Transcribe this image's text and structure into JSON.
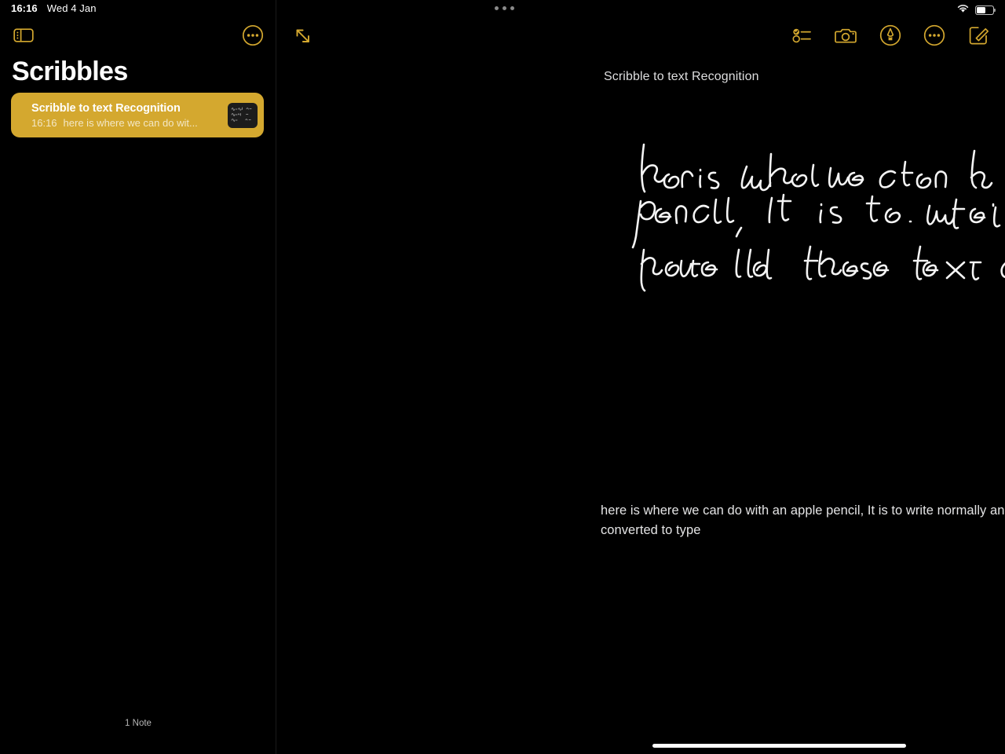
{
  "status_bar": {
    "time": "16:16",
    "date": "Wed 4 Jan",
    "multitask_dots_icon": "multitasking-dots-icon",
    "wifi_icon": "wifi-icon",
    "battery_icon": "battery-icon",
    "battery_level_percent": 47
  },
  "sidebar": {
    "toggle_icon": "sidebar-toggle-icon",
    "more_icon": "more-circle-icon",
    "title": "Scribbles",
    "note": {
      "title": "Scribble to text Recognition",
      "time": "16:16",
      "snippet": "here is where we can do wit...",
      "thumbnail_icon": "note-thumbnail-icon",
      "accent_color": "#d4a82f"
    },
    "footer_count": "1 Note"
  },
  "detail": {
    "expand_icon": "expand-diagonal-icon",
    "toolbar_icons": [
      {
        "name": "checklist-icon",
        "label": "Checklist"
      },
      {
        "name": "camera-icon",
        "label": "Camera"
      },
      {
        "name": "markup-pen-icon",
        "label": "Markup"
      },
      {
        "name": "more-circle-icon",
        "label": "More"
      },
      {
        "name": "compose-icon",
        "label": "New Note"
      }
    ],
    "note_heading": "Scribble to text Recognition",
    "handwriting_lines": [
      "here is what we can do with an apple",
      "pencil, It is to write normally and then",
      "have all these text converted to type"
    ],
    "converted_text": "here is where we can do with an apple pencil, It is to write normally and then have all these text converted to type",
    "home_indicator": "home-indicator"
  },
  "colors": {
    "accent": "#d4a82f",
    "background": "#000000",
    "ink": "#f2f2f2",
    "text_primary": "#ffffff",
    "text_secondary": "#b6b6b6"
  }
}
